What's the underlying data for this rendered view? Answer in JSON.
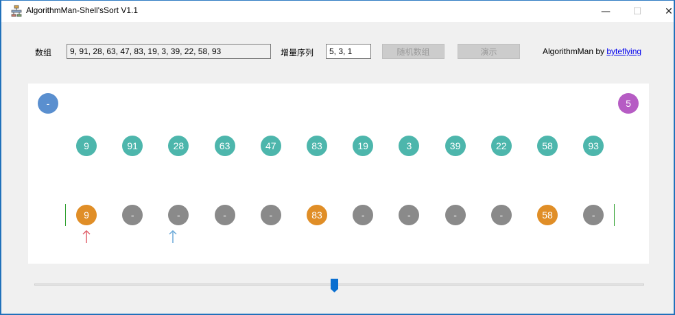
{
  "window": {
    "title": "AlgorithmMan-Shell'sSort V1.1",
    "minimize_glyph": "—",
    "maximize_glyph": "☐",
    "close_glyph": "✕"
  },
  "toolbar": {
    "array_label": "数组",
    "array_value": "9, 91, 28, 63, 47, 83, 19, 3, 39, 22, 58, 93",
    "sequence_label": "增量序列",
    "sequence_value": "5, 3, 1",
    "random_button": "随机数组",
    "demo_button": "演示",
    "credit_prefix": "AlgorithmMan by ",
    "credit_link": "byteflying"
  },
  "canvas": {
    "left_indicator": "-",
    "increment_indicator": "5",
    "array_circles": [
      "9",
      "91",
      "28",
      "63",
      "47",
      "83",
      "19",
      "3",
      "39",
      "22",
      "58",
      "93"
    ],
    "group_circles": [
      {
        "label": "9",
        "state": "orange"
      },
      {
        "label": "-",
        "state": "gray"
      },
      {
        "label": "-",
        "state": "gray"
      },
      {
        "label": "-",
        "state": "gray"
      },
      {
        "label": "-",
        "state": "gray"
      },
      {
        "label": "83",
        "state": "orange"
      },
      {
        "label": "-",
        "state": "gray"
      },
      {
        "label": "-",
        "state": "gray"
      },
      {
        "label": "-",
        "state": "gray"
      },
      {
        "label": "-",
        "state": "gray"
      },
      {
        "label": "58",
        "state": "orange"
      },
      {
        "label": "-",
        "state": "gray"
      }
    ]
  },
  "slider": {
    "position_fraction": 0.49
  },
  "colors": {
    "teal": "#4db6ac",
    "gray": "#8a8a8a",
    "orange": "#e08e27",
    "blue": "#5a8fcf",
    "purple": "#b65cc4",
    "arrow_red": "#e0606a",
    "arrow_blue": "#6aa9d8",
    "thumb": "#0a6fd0"
  },
  "icons": {
    "app": "flowchart-icon",
    "pointer_left": "up-arrow-icon",
    "pointer_right": "up-arrow-icon",
    "slider": "slider-thumb-icon"
  }
}
